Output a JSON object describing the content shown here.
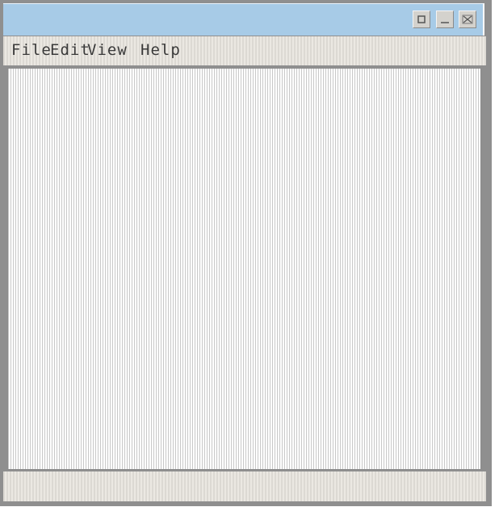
{
  "window": {
    "buttons": {
      "restore_icon": "restore-icon",
      "minimize_icon": "minimize-icon",
      "close_icon": "close-icon"
    }
  },
  "menubar": {
    "items": [
      {
        "label": "File"
      },
      {
        "label": "Edit"
      },
      {
        "label": "View"
      },
      {
        "label": "Help"
      }
    ]
  },
  "statusbar": {
    "text": ""
  },
  "colors": {
    "titlebar": "#a7cbe7",
    "frame": "#8f8f8f",
    "menubar": "#e3e0da",
    "client_stripe": "#c8c8c8"
  }
}
